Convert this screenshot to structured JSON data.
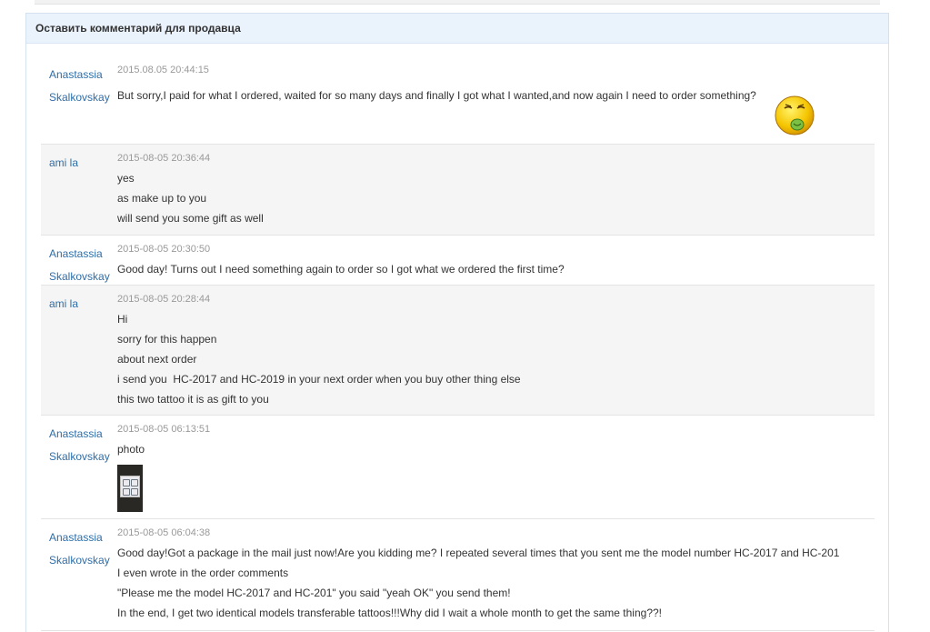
{
  "panel": {
    "title": "Оставить комментарий для продавца"
  },
  "messages": [
    {
      "role": "buyer",
      "author": [
        "Anastassia",
        "Skalkovskay"
      ],
      "date": "2015.08.05 20:44:15",
      "lines": [
        "But sorry,I paid for what I ordered, waited for so many days and finally I got what I wanted,and now again I need to order something?"
      ],
      "emoji": "sick-smiley-icon"
    },
    {
      "role": "seller",
      "author": [
        "ami la"
      ],
      "date": "2015-08-05 20:36:44",
      "lines": [
        "yes",
        "as make up to you",
        "will send you some gift as well"
      ]
    },
    {
      "role": "buyer",
      "author": [
        "Anastassia",
        "Skalkovskay"
      ],
      "date": "2015-08-05 20:30:50",
      "lines": [
        "Good day! Turns out I need something again to order so I got what we ordered the first time?"
      ]
    },
    {
      "role": "seller",
      "author": [
        "ami la"
      ],
      "date": "2015-08-05 20:28:44",
      "lines": [
        "Hi",
        "sorry for this happen",
        "about next order",
        "i send you  HC-2017 and HC-2019 in your next order when you buy other thing else",
        "this two tattoo it is as gift to you"
      ]
    },
    {
      "role": "buyer",
      "author": [
        "Anastassia",
        "Skalkovskay"
      ],
      "date": "2015-08-05 06:13:51",
      "lines": [
        "photo"
      ],
      "attachment": "photo-thumbnail"
    },
    {
      "role": "buyer",
      "author": [
        "Anastassia",
        "Skalkovskay"
      ],
      "date": "2015-08-05 06:04:38",
      "lines": [
        "Good day!Got a package in the mail just now!Are you kidding me? I repeated several times that you sent me the model number HC-2017 and HC-201",
        "I even wrote in the order comments",
        "\"Please me the model HC-2017 and HC-201\" you said \"yeah OK\" you send them!",
        "In the end, I get two identical models transferable tattoos!!!Why did I wait a whole month to get the same thing??!"
      ]
    }
  ]
}
